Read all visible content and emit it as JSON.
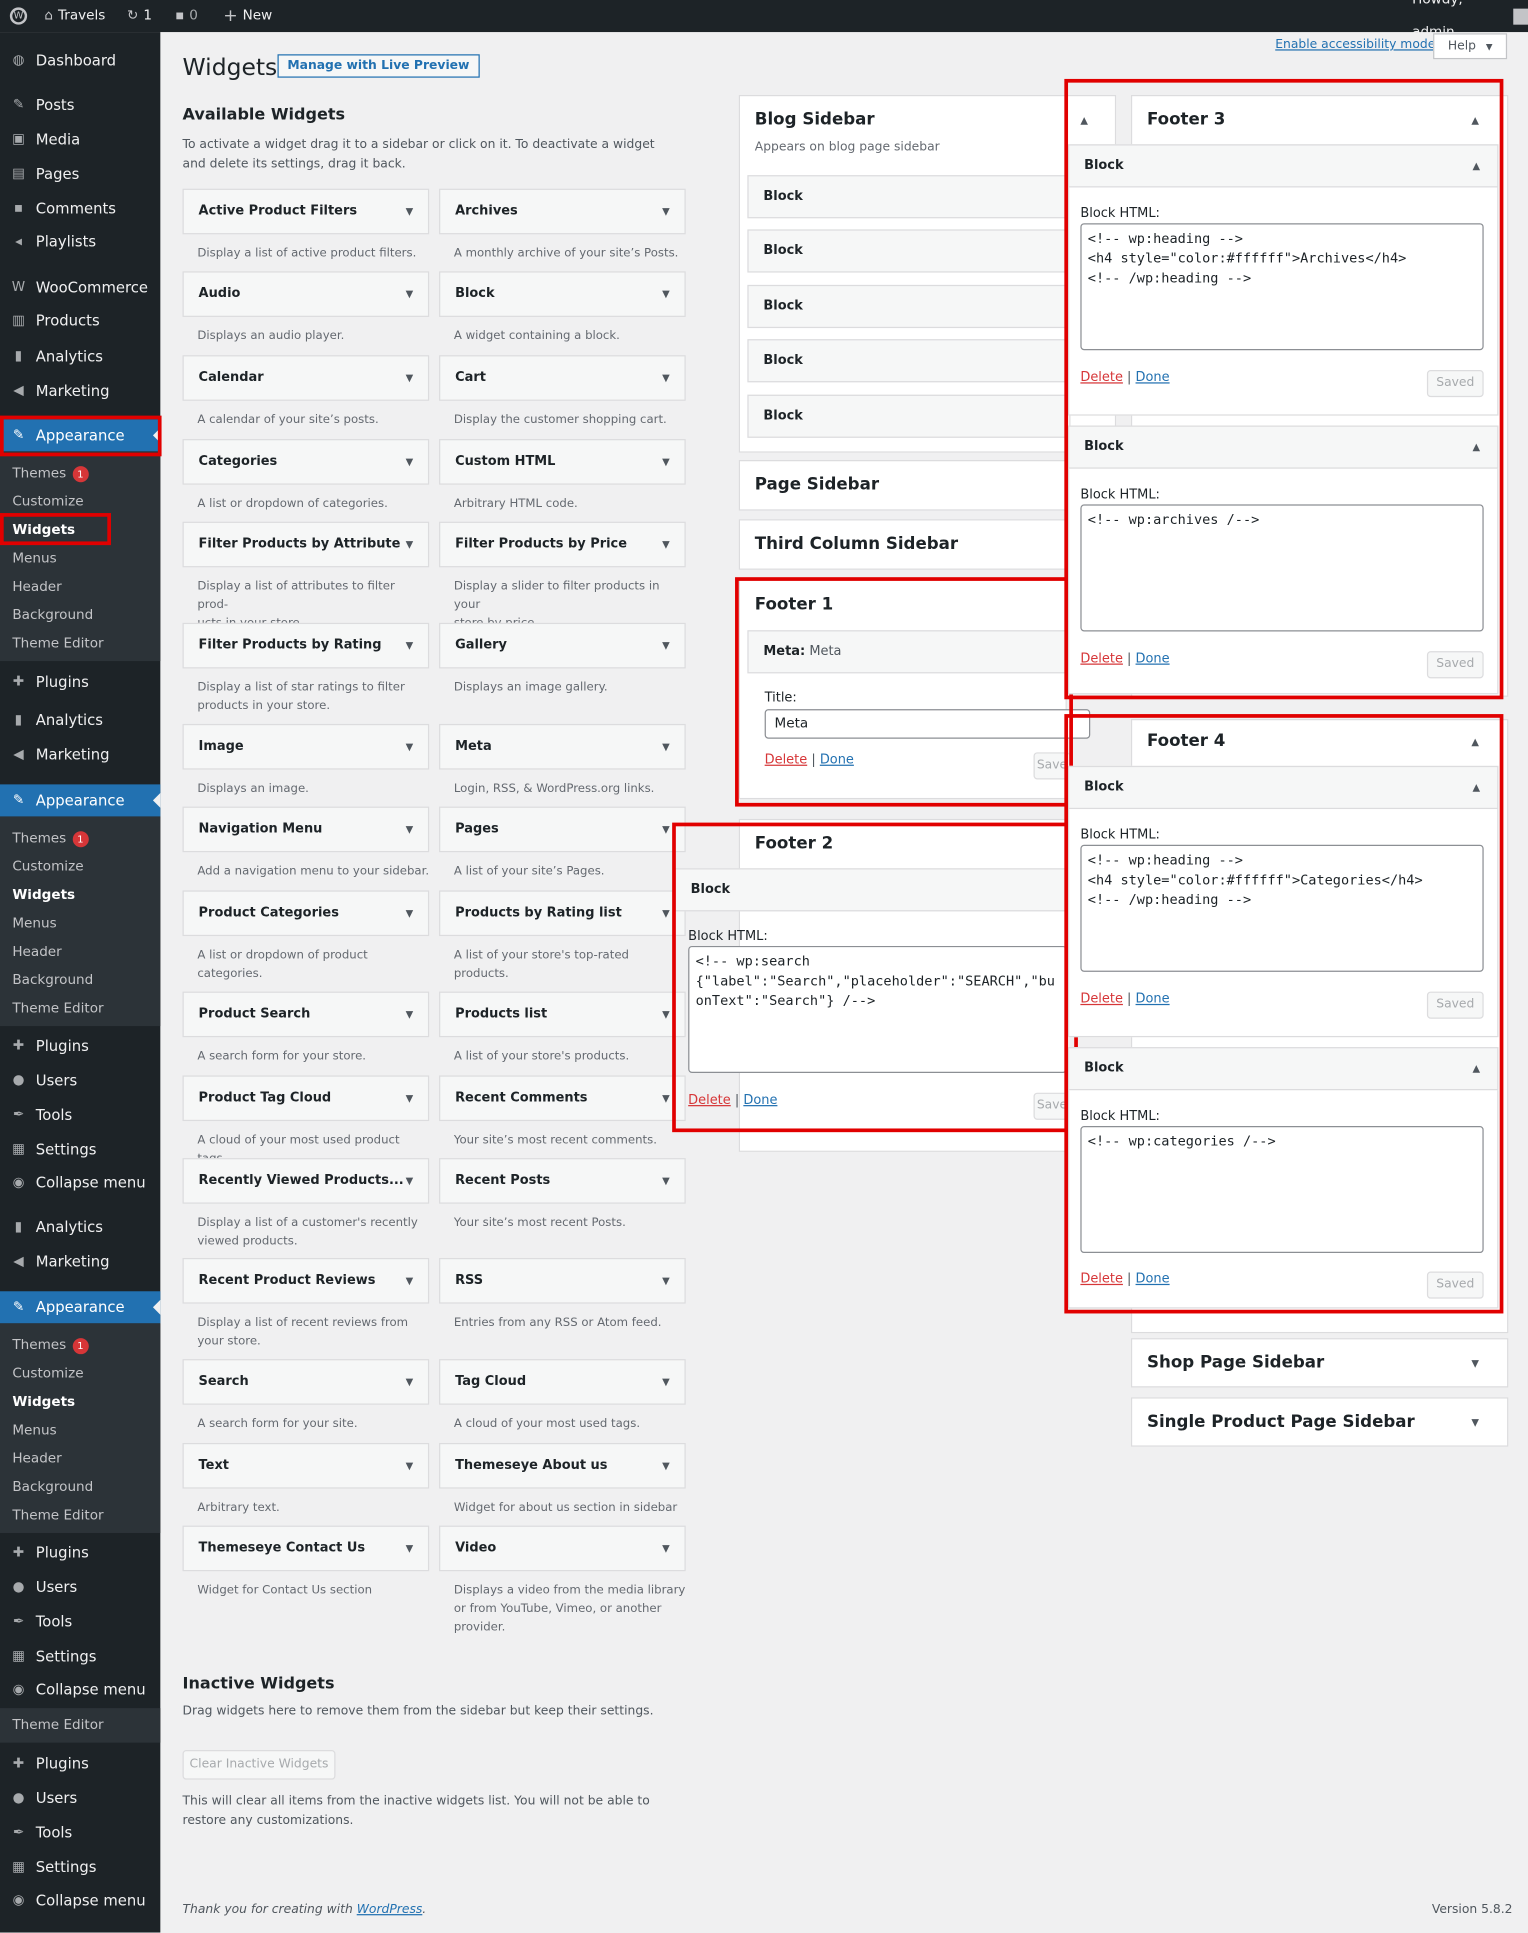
{
  "adminbar": {
    "site": "Travels",
    "updates": "1",
    "comments": "0",
    "new": "New",
    "howdy": "Howdy, admin"
  },
  "menu": {
    "dashboard": "Dashboard",
    "posts": "Posts",
    "media": "Media",
    "pages": "Pages",
    "comments": "Comments",
    "playlists": "Playlists",
    "woocommerce": "WooCommerce",
    "products": "Products",
    "analytics": "Analytics",
    "marketing": "Marketing",
    "appearance": "Appearance",
    "plugins": "Plugins",
    "users": "Users",
    "tools": "Tools",
    "settings": "Settings",
    "collapse": "Collapse menu"
  },
  "submenu": {
    "themes": "Themes",
    "themes_badge": "1",
    "customize": "Customize",
    "widgets": "Widgets",
    "menus": "Menus",
    "header": "Header",
    "background": "Background",
    "theme_editor": "Theme Editor"
  },
  "header": {
    "title": "Widgets",
    "live_preview": "Manage with Live Preview",
    "accessibility": "Enable accessibility mode",
    "help": "Help"
  },
  "available": {
    "title": "Available Widgets",
    "description": "To activate a widget drag it to a sidebar or click on it. To deactivate a widget and delete its settings, drag it back.",
    "widgets": [
      {
        "name": "Active Product Filters",
        "desc": "Display a list of active product filters."
      },
      {
        "name": "Archives",
        "desc": "A monthly archive of your site’s Posts."
      },
      {
        "name": "Audio",
        "desc": "Displays an audio player."
      },
      {
        "name": "Block",
        "desc": "A widget containing a block."
      },
      {
        "name": "Calendar",
        "desc": "A calendar of your site’s posts."
      },
      {
        "name": "Cart",
        "desc": "Display the customer shopping cart."
      },
      {
        "name": "Categories",
        "desc": "A list or dropdown of categories."
      },
      {
        "name": "Custom HTML",
        "desc": "Arbitrary HTML code."
      },
      {
        "name": "Filter Products by Attribute",
        "desc": "Display a list of attributes to filter prod-\nucts in your store."
      },
      {
        "name": "Filter Products by Price",
        "desc": "Display a slider to filter products in your\nstore by price."
      },
      {
        "name": "Filter Products by Rating",
        "desc": "Display a list of star ratings to filter\nproducts in your store."
      },
      {
        "name": "Gallery",
        "desc": "Displays an image gallery."
      },
      {
        "name": "Image",
        "desc": "Displays an image."
      },
      {
        "name": "Meta",
        "desc": "Login, RSS, & WordPress.org links."
      },
      {
        "name": "Navigation Menu",
        "desc": "Add a navigation menu to your sidebar."
      },
      {
        "name": "Pages",
        "desc": "A list of your site’s Pages."
      },
      {
        "name": "Product Categories",
        "desc": "A list or dropdown of product\ncategories."
      },
      {
        "name": "Products by Rating list",
        "desc": "A list of your store's top-rated\nproducts."
      },
      {
        "name": "Product Search",
        "desc": "A search form for your store."
      },
      {
        "name": "Products list",
        "desc": "A list of your store's products."
      },
      {
        "name": "Product Tag Cloud",
        "desc": "A cloud of your most used product tags."
      },
      {
        "name": "Recent Comments",
        "desc": "Your site’s most recent comments."
      },
      {
        "name": "Recently Viewed Products...",
        "desc": "Display a list of a customer's recently\nviewed products."
      },
      {
        "name": "Recent Posts",
        "desc": "Your site’s most recent Posts."
      },
      {
        "name": "Recent Product Reviews",
        "desc": "Display a list of recent reviews from\nyour store."
      },
      {
        "name": "RSS",
        "desc": "Entries from any RSS or Atom feed."
      },
      {
        "name": "Search",
        "desc": "A search form for your site."
      },
      {
        "name": "Tag Cloud",
        "desc": "A cloud of your most used tags."
      },
      {
        "name": "Text",
        "desc": "Arbitrary text."
      },
      {
        "name": "Themeseye About us",
        "desc": "Widget for about us section in sidebar"
      },
      {
        "name": "Themeseye Contact Us",
        "desc": "Widget for Contact Us section"
      },
      {
        "name": "Video",
        "desc": "Displays a video from the media library\nor from YouTube, Vimeo, or another\nprovider."
      }
    ]
  },
  "inactive": {
    "title": "Inactive Widgets",
    "description": "Drag widgets here to remove them from the sidebar but keep their settings.",
    "clear": "Clear Inactive Widgets",
    "note": "This will clear all items from the inactive widgets list. You will not be able to restore any customizations."
  },
  "sidebars": {
    "blog": {
      "title": "Blog Sidebar",
      "desc": "Appears on blog page sidebar",
      "block": "Block"
    },
    "page": {
      "title": "Page Sidebar"
    },
    "third": {
      "title": "Third Column Sidebar"
    },
    "footer1": {
      "title": "Footer 1",
      "widget": "Meta:",
      "widget_sub": "Meta",
      "title_label": "Title:",
      "title_value": "Meta"
    },
    "footer2": {
      "title": "Footer 2",
      "block": "Block",
      "label": "Block HTML:",
      "html": "<!-- wp:search\n{\"label\":\"Search\",\"placeholder\":\"SEARCH\",\"bu\nonText\":\"Search\"} /-->"
    },
    "footer3": {
      "title": "Footer 3",
      "block": "Block",
      "label": "Block HTML:",
      "html1": "<!-- wp:heading -->\n<h4 style=\"color:#ffffff\">Archives</h4>\n<!-- /wp:heading -->",
      "html2": "<!-- wp:archives /-->"
    },
    "footer4": {
      "title": "Footer 4",
      "block": "Block",
      "label": "Block HTML:",
      "html1": "<!-- wp:heading -->\n<h4 style=\"color:#ffffff\">Categories</h4>\n<!-- /wp:heading -->",
      "html2": "<!-- wp:categories /-->"
    },
    "shop": {
      "title": "Shop Page Sidebar"
    },
    "single": {
      "title": "Single Product Page Sidebar"
    }
  },
  "actions": {
    "delete": "Delete",
    "sep": "|",
    "done": "Done",
    "saved": "Saved",
    "save": "Save"
  },
  "footer": {
    "thanks": "Thank you for creating with",
    "wp": "WordPress",
    "period": ".",
    "version": "Version 5.8.2"
  },
  "colors": {
    "accent": "#2271b1",
    "highlight": "#e10000",
    "admin_bg": "#1d2327"
  }
}
